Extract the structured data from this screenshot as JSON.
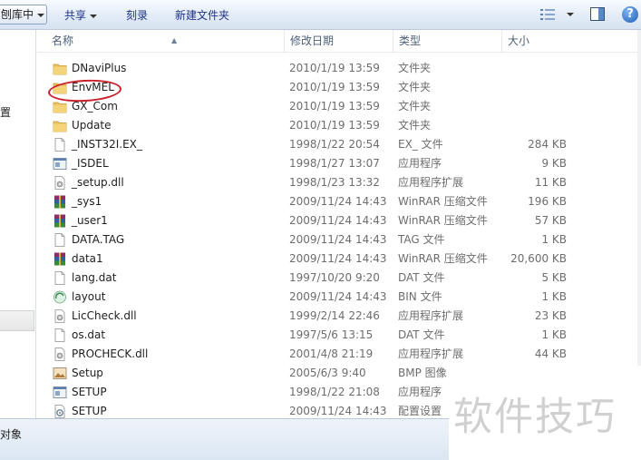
{
  "toolbar": {
    "library_label": "刨库中",
    "share_label": "共享",
    "burn_label": "刻录",
    "new_folder_label": "新建文件夹",
    "views_icon": "views-icon",
    "preview_icon": "preview-pane-icon",
    "help_icon": "help-icon",
    "help_glyph": "?"
  },
  "nav": {
    "partial_label": "置"
  },
  "columns": {
    "name": "名称",
    "date": "修改日期",
    "type": "类型",
    "size": "大小"
  },
  "files": [
    {
      "name": "DNaviPlus",
      "date": "2010/1/19 13:59",
      "type": "文件夹",
      "size": "",
      "icon": "folder"
    },
    {
      "name": "EnvMEL",
      "date": "2010/1/19 13:59",
      "type": "文件夹",
      "size": "",
      "icon": "folder"
    },
    {
      "name": "GX_Com",
      "date": "2010/1/19 13:59",
      "type": "文件夹",
      "size": "",
      "icon": "folder"
    },
    {
      "name": "Update",
      "date": "2010/1/19 13:59",
      "type": "文件夹",
      "size": "",
      "icon": "folder"
    },
    {
      "name": "_INST32I.EX_",
      "date": "1998/1/22 20:54",
      "type": "EX_ 文件",
      "size": "284 KB",
      "icon": "file"
    },
    {
      "name": "_ISDEL",
      "date": "1998/1/27 13:07",
      "type": "应用程序",
      "size": "9 KB",
      "icon": "exe"
    },
    {
      "name": "_setup.dll",
      "date": "1998/1/23 13:32",
      "type": "应用程序扩展",
      "size": "11 KB",
      "icon": "dll"
    },
    {
      "name": "_sys1",
      "date": "2009/11/24 14:43",
      "type": "WinRAR 压缩文件",
      "size": "196 KB",
      "icon": "rar"
    },
    {
      "name": "_user1",
      "date": "2009/11/24 14:43",
      "type": "WinRAR 压缩文件",
      "size": "57 KB",
      "icon": "rar"
    },
    {
      "name": "DATA.TAG",
      "date": "2009/11/24 14:43",
      "type": "TAG 文件",
      "size": "1 KB",
      "icon": "file"
    },
    {
      "name": "data1",
      "date": "2009/11/24 14:43",
      "type": "WinRAR 压缩文件",
      "size": "20,600 KB",
      "icon": "rar"
    },
    {
      "name": "lang.dat",
      "date": "1997/10/20 9:20",
      "type": "DAT 文件",
      "size": "5 KB",
      "icon": "file"
    },
    {
      "name": "layout",
      "date": "2009/11/24 14:43",
      "type": "BIN 文件",
      "size": "1 KB",
      "icon": "bin"
    },
    {
      "name": "LicCheck.dll",
      "date": "1999/2/14 22:46",
      "type": "应用程序扩展",
      "size": "23 KB",
      "icon": "dll"
    },
    {
      "name": "os.dat",
      "date": "1997/5/6 13:15",
      "type": "DAT 文件",
      "size": "1 KB",
      "icon": "file"
    },
    {
      "name": "PROCHECK.dll",
      "date": "2001/4/8 21:19",
      "type": "应用程序扩展",
      "size": "44 KB",
      "icon": "dll"
    },
    {
      "name": "Setup",
      "date": "2005/6/3 9:40",
      "type": "BMP 图像",
      "size": "",
      "icon": "bmp"
    },
    {
      "name": "SETUP",
      "date": "1998/1/22 21:08",
      "type": "应用程序",
      "size": "",
      "icon": "exe"
    },
    {
      "name": "SETUP",
      "date": "2009/11/24 14:43",
      "type": "配置设置",
      "size": "",
      "icon": "ini"
    }
  ],
  "status": {
    "text": "对象"
  },
  "watermark": "软件技巧",
  "colors": {
    "folder": "#e8c160",
    "annotation": "#c8202a"
  }
}
